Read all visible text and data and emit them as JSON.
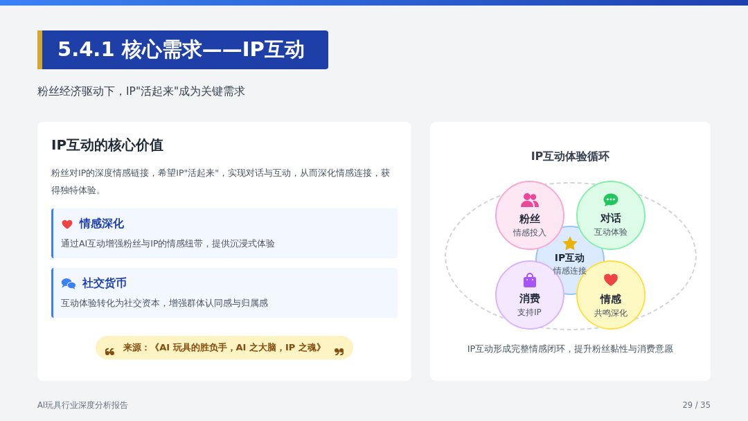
{
  "title": "5.4.1 核心需求——IP互动",
  "subtitle": "粉丝经济驱动下，IP\"活起来\"成为关键需求",
  "left_card": {
    "title": "IP互动的核心价值",
    "intro": "粉丝对IP的深度情感链接，希望IP\"活起来\"，实现对话与互动，从而深化情感连接，获得独特体验。",
    "items": [
      {
        "kind": "heart",
        "title": "情感深化",
        "text": "通过AI互动增强粉丝与IP的情感纽带，提供沉浸式体验"
      },
      {
        "kind": "chat",
        "title": "社交货币",
        "text": "互动体验转化为社交资本，增强群体认同感与归属感"
      }
    ],
    "source": "来源：《AI 玩具的胜负手，AI 之大脑，IP 之魂》"
  },
  "right_card": {
    "title": "IP互动体验循环",
    "center": {
      "label": "IP互动",
      "sub": "情感连接"
    },
    "nodes": [
      {
        "kind": "fans",
        "label": "粉丝",
        "sub": "情感投入"
      },
      {
        "kind": "dialog",
        "label": "对话",
        "sub": "互动体验"
      },
      {
        "kind": "spend",
        "label": "消费",
        "sub": "支持IP"
      },
      {
        "kind": "emotion",
        "label": "情感",
        "sub": "共鸣深化"
      }
    ],
    "caption": "IP互动形成完整情感闭环，提升粉丝黏性与消费意愿"
  },
  "footer": {
    "report": "AI玩具行业深度分析报告",
    "page": "29 / 35"
  }
}
